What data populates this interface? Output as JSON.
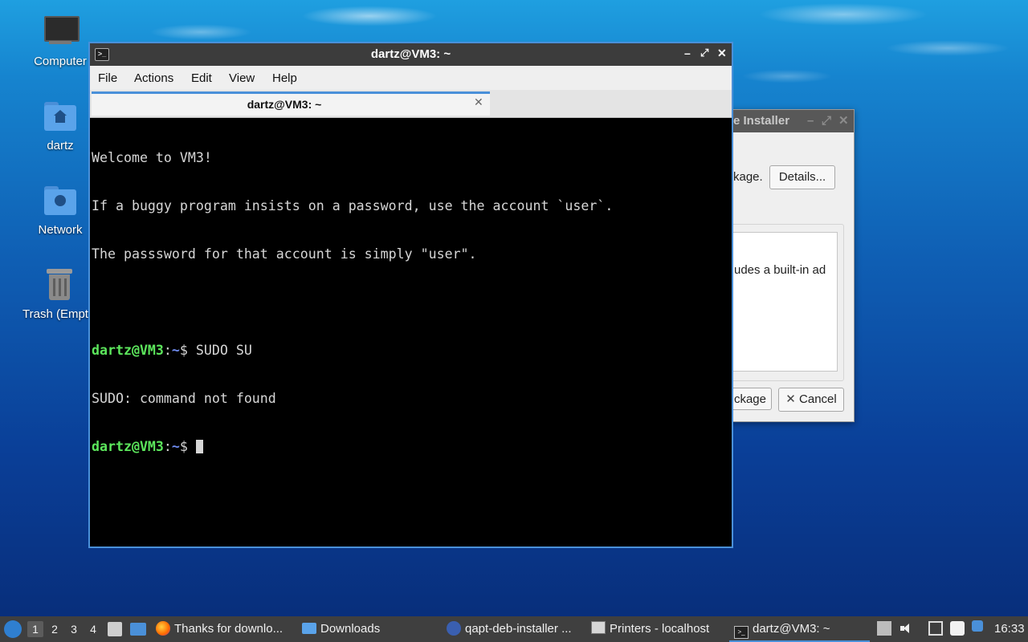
{
  "desktop": {
    "icons": [
      {
        "label": "Computer"
      },
      {
        "label": "dartz"
      },
      {
        "label": "Network"
      },
      {
        "label": "Trash (Empt"
      }
    ]
  },
  "installer_window": {
    "title_partial": "e Installer",
    "text_package": "kage.",
    "details_button": "Details...",
    "description_partial": "udes a built-in ad",
    "install_button_partial": "ckage",
    "cancel_button": "Cancel"
  },
  "terminal": {
    "title": "dartz@VM3: ~",
    "menu": [
      "File",
      "Actions",
      "Edit",
      "View",
      "Help"
    ],
    "tab_title": "dartz@VM3: ~",
    "welcome": [
      "Welcome to VM3!",
      "If a buggy program insists on a password, use the account `user`.",
      "The passsword for that account is simply \"user\"."
    ],
    "prompt_user": "dartz@VM3",
    "prompt_sep": ":",
    "prompt_path": "~",
    "prompt_dollar": "$ ",
    "command": "SUDO SU",
    "error_output": "SUDO: command not found"
  },
  "taskbar": {
    "workspaces": [
      "1",
      "2",
      "3",
      "4"
    ],
    "active_workspace": "1",
    "tasks": [
      {
        "label": "Thanks for downlo...",
        "icon": "firefox-icon"
      },
      {
        "label": "Downloads",
        "icon": "folder-icon"
      },
      {
        "label": "qapt-deb-installer ...",
        "icon": "installer-icon"
      },
      {
        "label": "Printers - localhost",
        "icon": "printer-icon"
      },
      {
        "label": "dartz@VM3: ~",
        "icon": "terminal-icon"
      }
    ],
    "clock": "16:33"
  }
}
